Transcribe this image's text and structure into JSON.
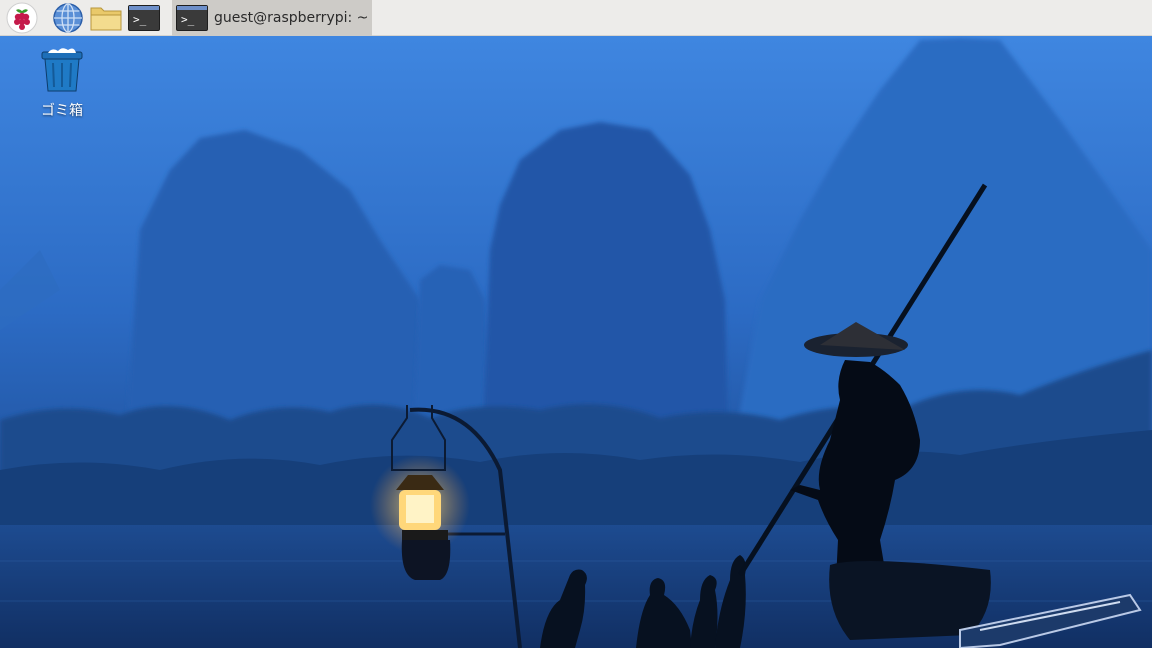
{
  "taskbar": {
    "launchers": [
      {
        "name": "raspberry-menu-icon"
      },
      {
        "name": "web-browser-icon"
      },
      {
        "name": "file-manager-icon"
      },
      {
        "name": "terminal-icon",
        "glyph": ">_"
      }
    ],
    "active_window": {
      "glyph": ">_",
      "title": "guest@raspberrypi: ~"
    }
  },
  "desktop": {
    "trash_label": "ゴミ箱"
  },
  "colors": {
    "taskbar_bg": "#edecea",
    "active_task_bg": "#cdcbc7",
    "sky_top": "#3f86e0",
    "sky_bottom": "#1d4f9c",
    "lantern_glow": "#ffcf6a"
  }
}
